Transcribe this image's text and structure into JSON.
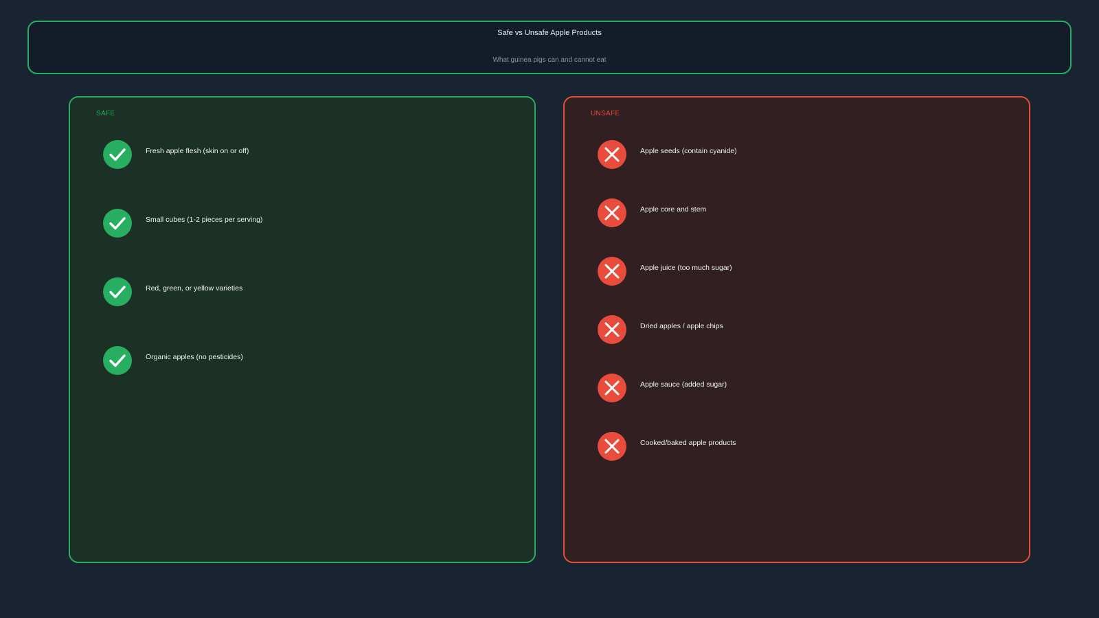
{
  "header": {
    "title": "Safe vs Unsafe Apple Products",
    "subtitle": "What guinea pigs can and cannot eat"
  },
  "safe": {
    "label": "SAFE",
    "accent": "#27ae60",
    "icon": "check-icon",
    "items": [
      "Fresh apple flesh (skin on or off)",
      "Small cubes (1-2 pieces per serving)",
      "Red, green, or yellow varieties",
      "Organic apples (no pesticides)"
    ]
  },
  "unsafe": {
    "label": "UNSAFE",
    "accent": "#e74c3c",
    "icon": "x-icon",
    "items": [
      "Apple seeds (contain cyanide)",
      "Apple core and stem",
      "Apple juice (too much sugar)",
      "Dried apples / apple chips",
      "Apple sauce (added sugar)",
      "Cooked/baked apple products"
    ]
  }
}
